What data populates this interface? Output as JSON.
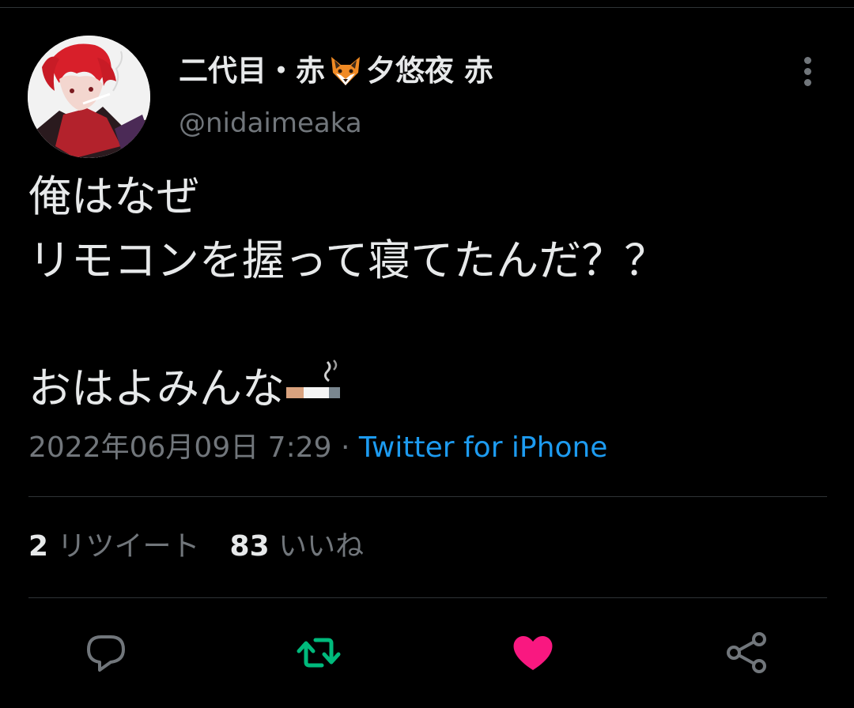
{
  "author": {
    "display_name_part1": "二代目・赤",
    "display_name_part2": "夕悠夜 赤",
    "name_emoji": "fox-face-icon",
    "handle": "@nidaimeaka"
  },
  "tweet": {
    "lines": [
      "俺はなぜ",
      "リモコンを握って寝てたんだ？？",
      "",
      "おはよみんな"
    ],
    "trailing_emoji": "cigarette-icon",
    "timestamp": "2022年06月09日 7:29",
    "separator": "·",
    "source": "Twitter for iPhone"
  },
  "stats": {
    "retweet_count": "2",
    "retweet_label": "リツイート",
    "like_count": "83",
    "like_label": "いいね"
  },
  "actions": [
    "reply-icon",
    "retweet-icon",
    "heart-icon",
    "share-icon"
  ],
  "colors": {
    "background": "#000000",
    "text": "#e7e9ea",
    "muted": "#71767b",
    "link": "#1d9bf0",
    "retweet": "#00ba7c",
    "like": "#f91880",
    "divider": "#2f3336"
  }
}
